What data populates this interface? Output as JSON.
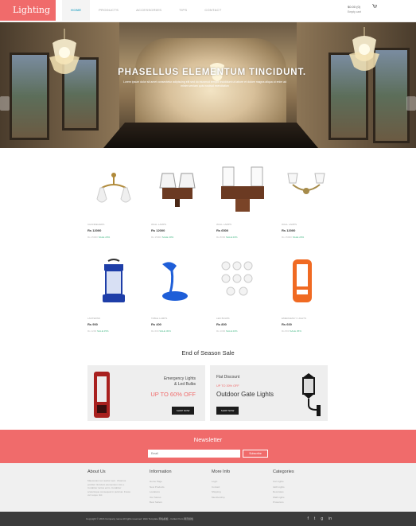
{
  "header": {
    "logo": "Lighting",
    "nav": [
      "Home",
      "Products",
      "Accessories",
      "Tips",
      "Contact"
    ],
    "active_nav": "Home",
    "cart_amount": "$0.00 (0)",
    "cart_status": "Empty cart"
  },
  "hero": {
    "title": "PHASELLUS ELEMENTUM TINCIDUNT.",
    "subtitle": "Lorem ipsum dolor sit amet consectetur adipiscing elit sed do eiusmod tempor incididunt ut labore et dolore magna aliqua ut enim ad minim veniam quis nostrud exercitation"
  },
  "products": [
    {
      "category": "CHANDELIERS",
      "price": "Rs 12000",
      "old": "Rs 15000",
      "new": "SALE 20%"
    },
    {
      "category": "WALL LAMPS",
      "price": "Rs 12000",
      "old": "Rs 15000",
      "new": "SALE 20%"
    },
    {
      "category": "WALL LAMPS",
      "price": "Rs 6500",
      "old": "Rs 8000",
      "new": "SALE 20%"
    },
    {
      "category": "WALL LAMPS",
      "price": "Rs 12000",
      "old": "Rs 15000",
      "new": "SALE 20%"
    },
    {
      "category": "LANTERNS",
      "price": "Rs 900",
      "old": "Rs 1200",
      "new": "SALE 25%"
    },
    {
      "category": "TABLE LAMPS",
      "price": "Rs 400",
      "old": "Rs 600",
      "new": "SALE 30%"
    },
    {
      "category": "LED BULBS",
      "price": "Rs 800",
      "old": "Rs 1000",
      "new": "SALE 20%"
    },
    {
      "category": "EMERGENCY LIGHTS",
      "price": "Rs 600",
      "old": "Rs 800",
      "new": "SALE 25%"
    }
  ],
  "sale": {
    "title": "End of Season Sale",
    "promo1": {
      "heading_line1": "Emergency Lights",
      "heading_line2": "& Led Bulbs",
      "offer": "UP TO 60% OFF",
      "button": "SHOP NOW"
    },
    "promo2": {
      "label": "Flat Discount",
      "offer": "UP TO 30% OFF",
      "title": "Outdoor Gate Lights",
      "button": "SHOP NOW"
    }
  },
  "newsletter": {
    "title": "Newsletter",
    "placeholder": "Email",
    "button": "Subscribe"
  },
  "footer": {
    "about_heading": "About Us",
    "about_text": "Maecenas nec auctor sem. Vivamus porttitor tincidunt elementum nisi a. Curabitur luctus enim. Curabitur scelerisque consequat in pulvinar. Fusce vel neque nisl.",
    "information_heading": "Information",
    "information_links": [
      "Home Page",
      "New Products",
      "Locations",
      "Our Stores",
      "Best Sellers"
    ],
    "more_heading": "More Info",
    "more_links": [
      "Login",
      "Contact",
      "Shipping",
      "Membership"
    ],
    "categories_heading": "Categories",
    "categories_links": [
      "Car Lights",
      "LED Lights",
      "Decorates",
      "Wall Lights",
      "Protectors"
    ],
    "copyright": "Copyright © 2016 Company name All rights reserved. Web Template 网站模板 - Collect from 网页模板",
    "social_icons": [
      "facebook-icon",
      "twitter-icon",
      "google-plus-icon",
      "linkedin-icon"
    ]
  },
  "colors": {
    "accent": "#f06b6b",
    "link": "#3aaac8",
    "dark": "#1c1c1c"
  }
}
